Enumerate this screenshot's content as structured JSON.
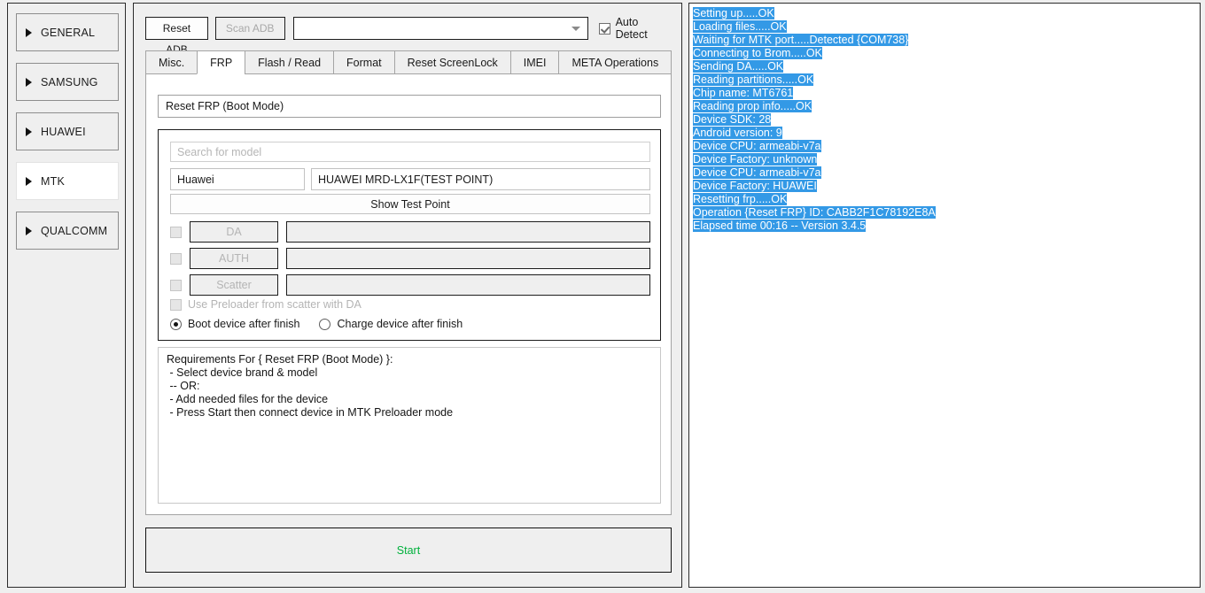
{
  "sidebar": {
    "items": [
      {
        "label": "GENERAL",
        "icon": "triangle-right-icon",
        "selected": false
      },
      {
        "label": "SAMSUNG",
        "icon": "triangle-right-icon",
        "selected": false
      },
      {
        "label": "HUAWEI",
        "icon": "triangle-right-icon",
        "selected": false
      },
      {
        "label": "MTK",
        "icon": "triangle-right-icon",
        "selected": true
      },
      {
        "label": "QUALCOMM",
        "icon": "triangle-right-icon",
        "selected": false
      }
    ]
  },
  "toolbar": {
    "reset_adb_label": "Reset ADB",
    "scan_adb_label": "Scan ADB",
    "device_combo_value": "",
    "auto_detect_label": "Auto Detect",
    "auto_detect_checked": true
  },
  "tabs": [
    {
      "label": "Misc.",
      "active": false
    },
    {
      "label": "FRP",
      "active": true
    },
    {
      "label": "Flash / Read",
      "active": false
    },
    {
      "label": "Format",
      "active": false
    },
    {
      "label": "Reset ScreenLock",
      "active": false
    },
    {
      "label": "IMEI",
      "active": false
    },
    {
      "label": "META Operations",
      "active": false
    }
  ],
  "frp": {
    "operation_value": "Reset FRP (Boot Mode)",
    "search_placeholder": "Search for model",
    "search_value": "",
    "brand_value": "Huawei",
    "model_value": "HUAWEI MRD-LX1F(TEST POINT)",
    "show_test_point_label": "Show Test Point",
    "file_rows": [
      {
        "label": "DA",
        "checked": false,
        "value": ""
      },
      {
        "label": "AUTH",
        "checked": false,
        "value": ""
      },
      {
        "label": "Scatter",
        "checked": false,
        "value": ""
      }
    ],
    "preloader_label": "Use Preloader from scatter with DA",
    "preloader_checked": false,
    "radio_boot_label": "Boot device after finish",
    "radio_boot_selected": true,
    "radio_charge_label": "Charge device after finish",
    "radio_charge_selected": false,
    "requirements_text": "Requirements For { Reset FRP (Boot Mode) }:\n - Select device brand & model\n -- OR:\n - Add needed files for the device\n - Press Start then connect device in MTK Preloader mode"
  },
  "start_button": {
    "label": "Start",
    "color": "#00b13c"
  },
  "log": {
    "selection_color": "#3399e6",
    "lines": [
      "Setting up.....OK",
      "Loading files.....OK",
      "Waiting for MTK port.....Detected {COM738}",
      "Connecting to Brom.....OK",
      "Sending DA.....OK",
      "Reading partitions.....OK",
      "Chip name: MT6761",
      "Reading prop info.....OK",
      "Device SDK: 28",
      "Android version: 9",
      "Device CPU: armeabi-v7a",
      "Device Factory: unknown",
      "Device CPU: armeabi-v7a",
      "Device Factory: HUAWEI",
      "Resetting frp.....OK",
      "Operation {Reset FRP} ID: CABB2F1C78192E8A",
      "Elapsed time 00:16 -- Version 3.4.5"
    ]
  }
}
